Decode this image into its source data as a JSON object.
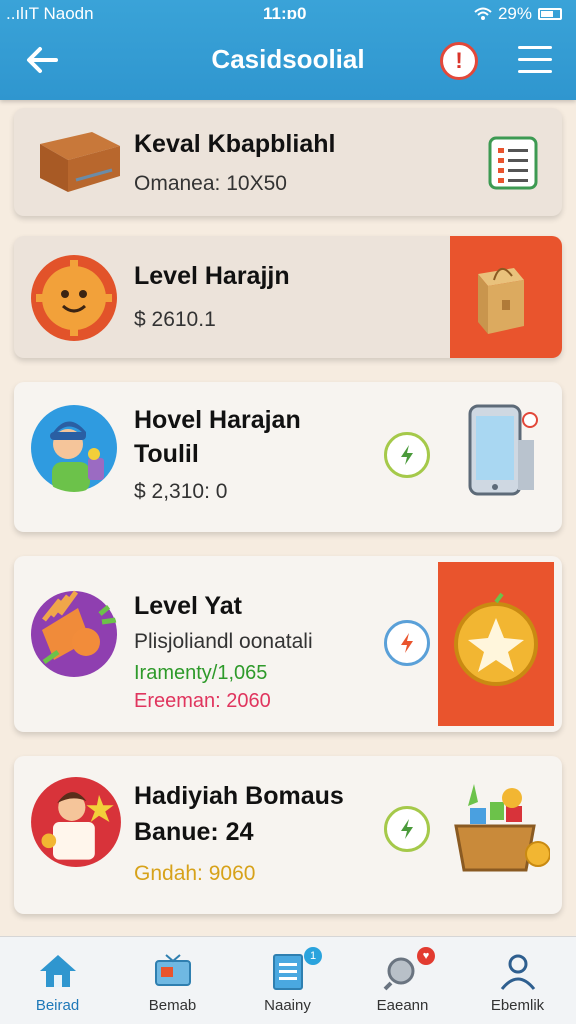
{
  "status_bar": {
    "carrier": "..ılıT Naodn",
    "time": "11:ɒ0",
    "battery": "29%"
  },
  "header": {
    "title": "Casidsoolial",
    "alert_glyph": "!"
  },
  "cards": [
    {
      "title": "Keval Kbapbliahl",
      "lines": [
        "Omanea: 10X50"
      ],
      "icon": "box-icon",
      "action_icon": "checklist-icon"
    },
    {
      "title": "Level Harajjn",
      "lines": [
        "$ 2610.1"
      ],
      "icon": "gear-smile-icon",
      "action_icon": "shopping-bag-icon"
    },
    {
      "title": "Hovel Harajan",
      "title2": "Toulil",
      "lines": [
        "$ 2,310: 0"
      ],
      "icon": "person-avatar-icon",
      "action_icon": "phone-icon"
    },
    {
      "title": "Level Yat",
      "lines": [
        "Plisjoliandl oonatali",
        "Iramenty/1,065",
        "Ereeman: 2060"
      ],
      "icon": "party-icon",
      "action_icon": "gold-coin-icon"
    },
    {
      "title": "Hadiyiah Bomaus",
      "title2": "Banue: 24",
      "lines": [
        "Gndah: 9060"
      ],
      "icon": "gift-person-icon",
      "action_icon": "treasure-basket-icon"
    }
  ],
  "bottom_nav": [
    {
      "label": "Beirad",
      "icon": "home-icon"
    },
    {
      "label": "Bemab",
      "icon": "tv-icon"
    },
    {
      "label": "Naainy",
      "icon": "document-icon",
      "badge": "1"
    },
    {
      "label": "Eaeann",
      "icon": "search-heart-icon",
      "badge": "♥"
    },
    {
      "label": "Ebemlik",
      "icon": "profile-icon"
    }
  ],
  "colors": {
    "header": "#3aa3d8",
    "accent_orange": "#e9542d",
    "background": "#f6ece0"
  }
}
